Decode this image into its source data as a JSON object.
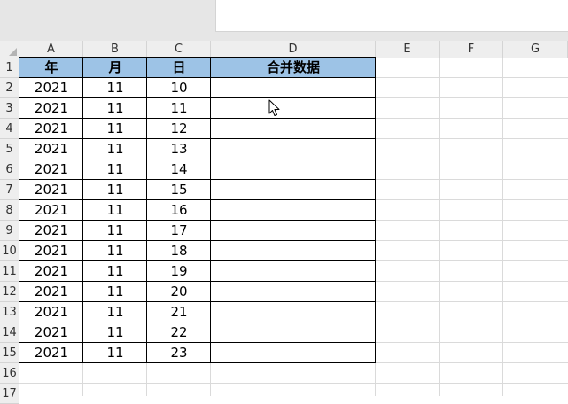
{
  "columns": [
    "A",
    "B",
    "C",
    "D",
    "E",
    "F",
    "G"
  ],
  "rows": [
    "1",
    "2",
    "3",
    "4",
    "5",
    "6",
    "7",
    "8",
    "9",
    "10",
    "11",
    "12",
    "13",
    "14",
    "15",
    "16",
    "17"
  ],
  "table": {
    "headers": [
      "年",
      "月",
      "日",
      "合并数据"
    ],
    "header_color": "#9dc3e6",
    "data": [
      [
        "2021",
        "11",
        "10",
        ""
      ],
      [
        "2021",
        "11",
        "11",
        ""
      ],
      [
        "2021",
        "11",
        "12",
        ""
      ],
      [
        "2021",
        "11",
        "13",
        ""
      ],
      [
        "2021",
        "11",
        "14",
        ""
      ],
      [
        "2021",
        "11",
        "15",
        ""
      ],
      [
        "2021",
        "11",
        "16",
        ""
      ],
      [
        "2021",
        "11",
        "17",
        ""
      ],
      [
        "2021",
        "11",
        "18",
        ""
      ],
      [
        "2021",
        "11",
        "19",
        ""
      ],
      [
        "2021",
        "11",
        "20",
        ""
      ],
      [
        "2021",
        "11",
        "21",
        ""
      ],
      [
        "2021",
        "11",
        "22",
        ""
      ],
      [
        "2021",
        "11",
        "23",
        ""
      ]
    ]
  },
  "icons": {
    "cursor": "mouse-pointer-icon",
    "select_all": "select-all-triangle-icon"
  }
}
